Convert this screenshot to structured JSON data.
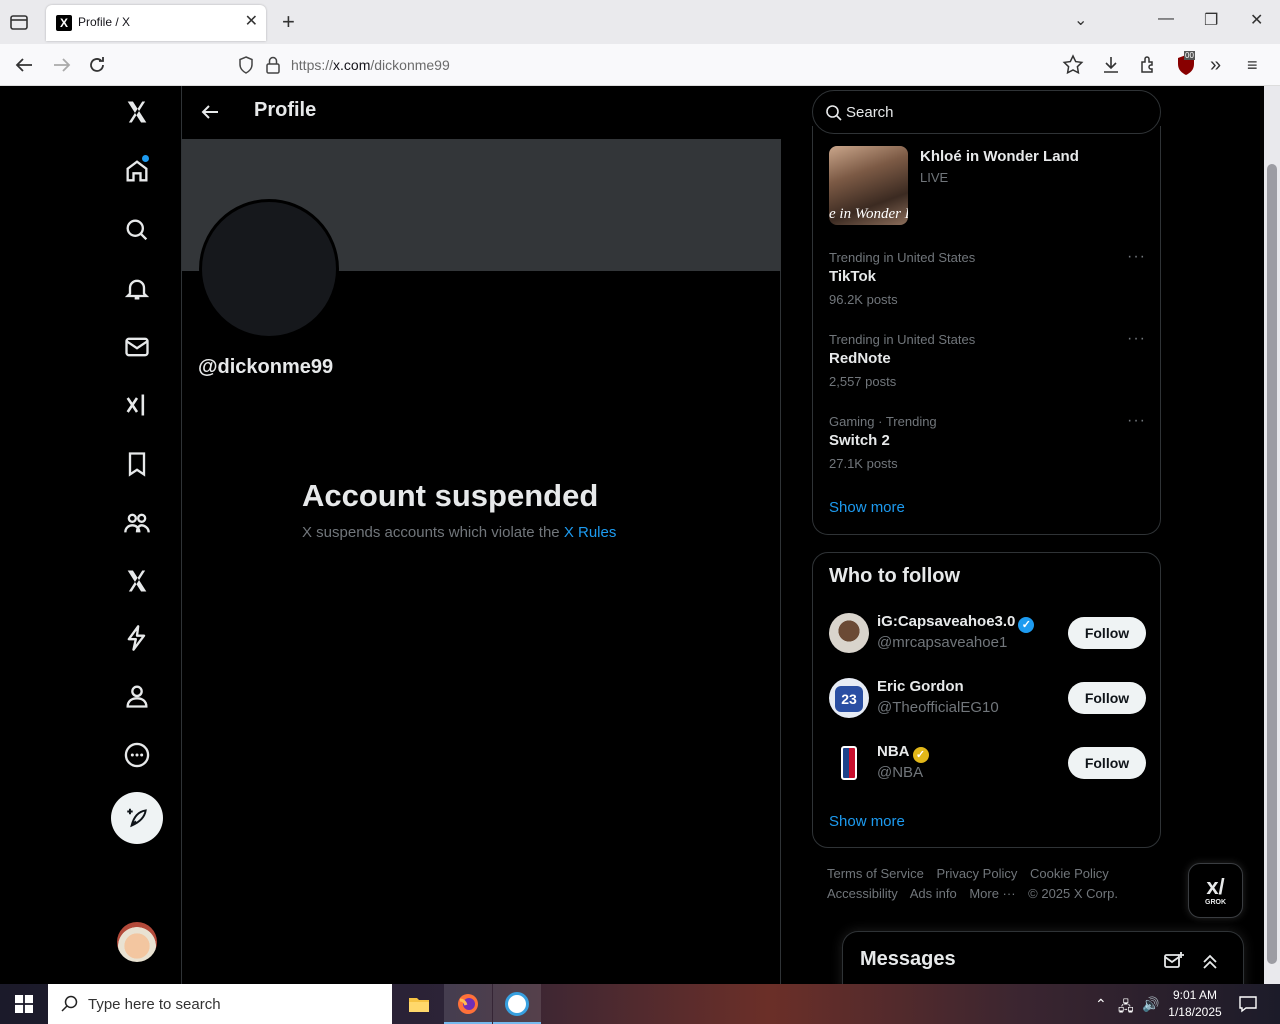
{
  "browser": {
    "tab_title": "Profile / X",
    "tab_favicon": "X",
    "url_prefix": "https://",
    "url_domain": "x.com",
    "url_path": "/dickonme99",
    "extension_badge": "00"
  },
  "nav": {
    "icons": [
      "x-logo-icon",
      "home-icon",
      "explore-icon",
      "notifications-icon",
      "messages-icon",
      "grok-icon",
      "bookmarks-icon",
      "communities-icon",
      "premium-icon",
      "verified-orgs-icon",
      "profile-icon",
      "more-icon",
      "post-icon"
    ]
  },
  "main": {
    "header_title": "Profile",
    "handle": "@dickonme99",
    "suspended_title": "Account suspended",
    "suspended_desc": "X suspends accounts which violate the ",
    "rules_link": "X Rules"
  },
  "sidebar": {
    "search_placeholder": "Search",
    "live": {
      "name": "Khloé in Wonder Land",
      "status": "LIVE",
      "thumb_text": "e in Wonder L"
    },
    "trends": [
      {
        "meta": "Trending in United States",
        "name": "TikTok",
        "count": "96.2K posts"
      },
      {
        "meta": "Trending in United States",
        "name": "RedNote",
        "count": "2,557 posts"
      },
      {
        "meta": "Gaming · Trending",
        "name": "Switch 2",
        "count": "27.1K posts"
      }
    ],
    "trends_show_more": "Show more",
    "who_to_follow": {
      "title": "Who to follow",
      "accounts": [
        {
          "name": "iG:Capsaveahoe3.0",
          "handle": "@mrcapsaveahoe1",
          "button": "Follow",
          "badge_color": "#1d9bf0"
        },
        {
          "name": "Eric Gordon",
          "handle": "@TheofficialEG10",
          "button": "Follow",
          "jersey": "23"
        },
        {
          "name": "NBA",
          "handle": "@NBA",
          "button": "Follow",
          "badge_color": "#e2b719"
        }
      ],
      "show_more": "Show more"
    },
    "footer": {
      "terms": "Terms of Service",
      "privacy": "Privacy Policy",
      "cookie": "Cookie Policy",
      "accessibility": "Accessibility",
      "ads": "Ads info",
      "more": "More ···",
      "copyright": "© 2025 X Corp."
    }
  },
  "grok": {
    "mark": "x/",
    "label": "GROK"
  },
  "messages": {
    "title": "Messages"
  },
  "taskbar": {
    "search_placeholder": "Type here to search",
    "time": "9:01 AM",
    "date": "1/18/2025"
  },
  "colors": {
    "accent": "#1d9bf0",
    "background": "#000000",
    "border": "#2f3336",
    "muted": "#71767b"
  }
}
